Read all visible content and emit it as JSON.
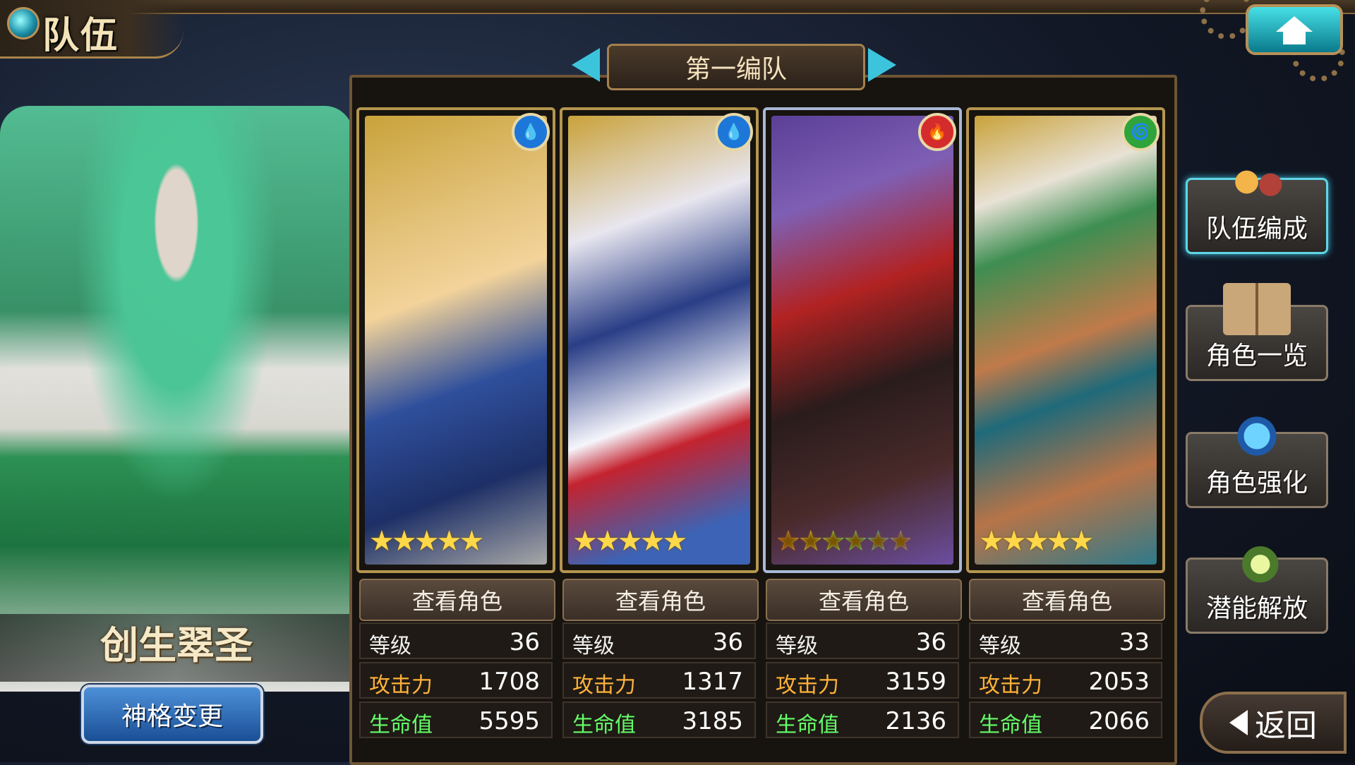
{
  "header": {
    "title": "队伍"
  },
  "leader": {
    "name": "创生翠圣",
    "change_button": "神格变更"
  },
  "team": {
    "name": "第一编队"
  },
  "cards": [
    {
      "element": "water",
      "element_glyph": "💧",
      "element_color": "#1d77d8",
      "stars": "★★★★★",
      "rarity": 5,
      "view_label": "查看角色",
      "level_label": "等级",
      "level": "36",
      "atk_label": "攻击力",
      "atk": "1708",
      "hp_label": "生命值",
      "hp": "5595"
    },
    {
      "element": "water",
      "element_glyph": "💧",
      "element_color": "#1d77d8",
      "stars": "★★★★★",
      "rarity": 5,
      "view_label": "查看角色",
      "level_label": "等级",
      "level": "36",
      "atk_label": "攻击力",
      "atk": "1317",
      "hp_label": "生命值",
      "hp": "3185"
    },
    {
      "element": "fire",
      "element_glyph": "🔥",
      "element_color": "#d42c2c",
      "stars": "★★★★★★",
      "rarity": 6,
      "view_label": "查看角色",
      "level_label": "等级",
      "level": "36",
      "atk_label": "攻击力",
      "atk": "3159",
      "hp_label": "生命值",
      "hp": "2136"
    },
    {
      "element": "wind",
      "element_glyph": "🌀",
      "element_color": "#2fa43a",
      "stars": "★★★★★",
      "rarity": 5,
      "view_label": "查看角色",
      "level_label": "等级",
      "level": "33",
      "atk_label": "攻击力",
      "atk": "2053",
      "hp_label": "生命值",
      "hp": "2066"
    }
  ],
  "side_menu": [
    {
      "label": "队伍编成",
      "icon": "team-members-icon",
      "active": true
    },
    {
      "label": "角色一览",
      "icon": "book-icon",
      "active": false
    },
    {
      "label": "角色强化",
      "icon": "card-upgrade-icon",
      "active": false
    },
    {
      "label": "潜能解放",
      "icon": "potential-orb-icon",
      "active": false
    }
  ],
  "back_button": {
    "label": "返回"
  }
}
